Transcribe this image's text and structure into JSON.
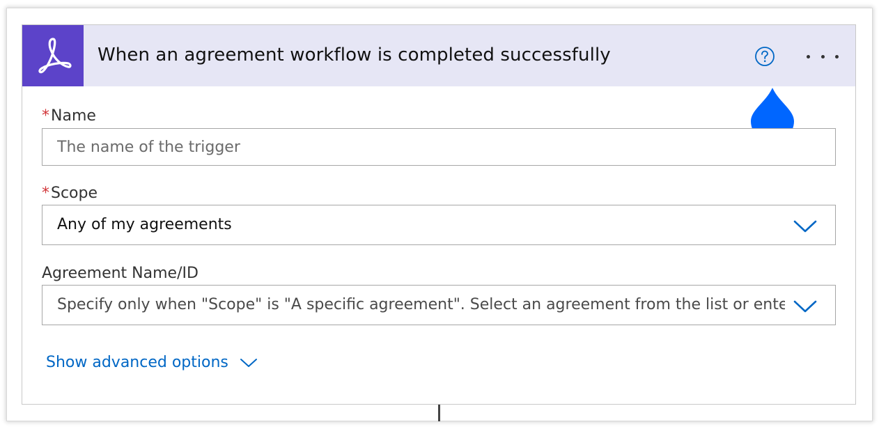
{
  "trigger": {
    "title": "When an agreement workflow is completed successfully",
    "icons": {
      "logo": "adobe-acrobat-sign-icon",
      "help": "question-circle-icon",
      "more": "more-ellipsis-icon",
      "cursor": "touch-droplet-icon"
    },
    "colors": {
      "logo_bg": "#5c43c9",
      "header_bg": "#e6e6f5",
      "accent": "#0067c5",
      "required": "#d13438",
      "droplet": "#0066ff"
    }
  },
  "fields": {
    "name": {
      "required_mark": "*",
      "label": "Name",
      "value": "",
      "placeholder": "The name of the trigger"
    },
    "scope": {
      "required_mark": "*",
      "label": "Scope",
      "selected": "Any of my agreements"
    },
    "agreement": {
      "label": "Agreement Name/ID",
      "placeholder": "Specify only when \"Scope\" is \"A specific agreement\". Select an agreement from the list or enter the ID"
    }
  },
  "advanced": {
    "label": "Show advanced options"
  }
}
